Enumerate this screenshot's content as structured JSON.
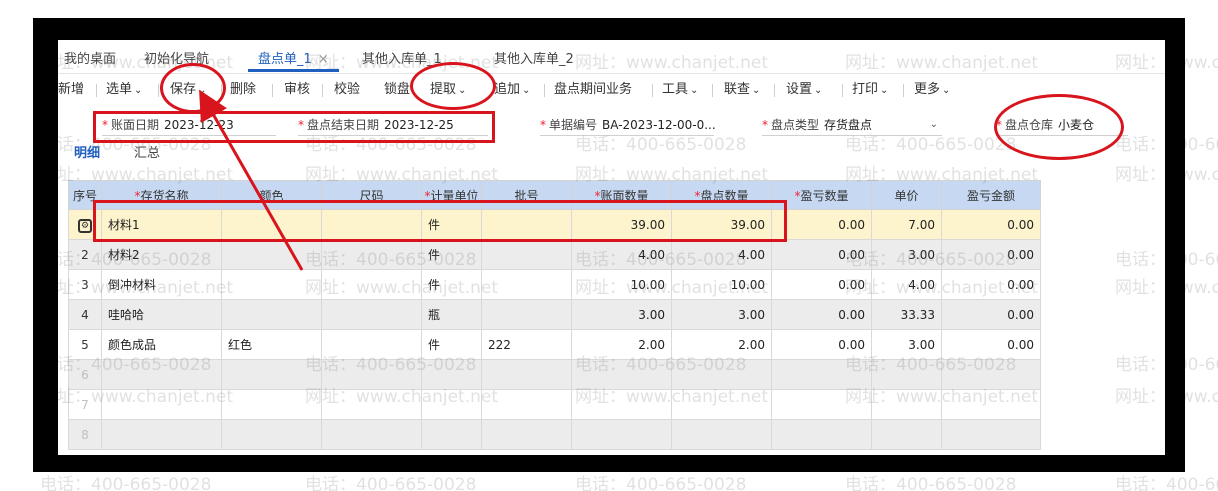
{
  "tabs": {
    "items": [
      {
        "label": "我的桌面"
      },
      {
        "label": "初始化导航"
      },
      {
        "label": "盘点单_1"
      },
      {
        "label": "其他入库单_1"
      },
      {
        "label": "其他入库单_2"
      }
    ],
    "close_glyph": "×"
  },
  "toolbar": {
    "new": "新增",
    "select": "选单",
    "save": "保存",
    "delete": "删除",
    "audit": "审核",
    "verify": "校验",
    "lock": "锁盘",
    "extract": "提取",
    "append": "追加",
    "period_business": "盘点期间业务",
    "tools": "工具",
    "linked": "联查",
    "settings": "设置",
    "print": "打印",
    "more": "更多",
    "chevron": "⌄"
  },
  "form": {
    "book_date": {
      "label": "账面日期",
      "value": "2023-12-23"
    },
    "count_end_date": {
      "label": "盘点结束日期",
      "value": "2023-12-25"
    },
    "doc_no": {
      "label": "单据编号",
      "value": "BA-2023-12-00-0..."
    },
    "count_type": {
      "label": "盘点类型",
      "value": "存货盘点"
    },
    "warehouse": {
      "label": "盘点仓库",
      "value": "小麦仓"
    },
    "required_mark": "*"
  },
  "subtabs": {
    "detail": "明细",
    "summary": "汇总"
  },
  "grid": {
    "headers": {
      "idx": "序号",
      "name": "存货名称",
      "color": "颜色",
      "size": "尺码",
      "unit": "计量单位",
      "batch": "批号",
      "book_qty": "账面数量",
      "count_qty": "盘点数量",
      "diff_qty": "盈亏数量",
      "price": "单价",
      "diff_amt": "盈亏金额"
    },
    "required_mark": "*",
    "rows": [
      {
        "idx": "",
        "name": "材料1",
        "color": "",
        "size": "",
        "unit": "件",
        "batch": "",
        "book_qty": "39.00",
        "count_qty": "39.00",
        "diff_qty": "0.00",
        "price": "7.00",
        "diff_amt": "0.00"
      },
      {
        "idx": "2",
        "name": "材料2",
        "color": "",
        "size": "",
        "unit": "件",
        "batch": "",
        "book_qty": "4.00",
        "count_qty": "4.00",
        "diff_qty": "0.00",
        "price": "3.00",
        "diff_amt": "0.00"
      },
      {
        "idx": "3",
        "name": "倒冲材料",
        "color": "",
        "size": "",
        "unit": "件",
        "batch": "",
        "book_qty": "10.00",
        "count_qty": "10.00",
        "diff_qty": "0.00",
        "price": "4.00",
        "diff_amt": "0.00"
      },
      {
        "idx": "4",
        "name": "哇哈哈",
        "color": "",
        "size": "",
        "unit": "瓶",
        "batch": "",
        "book_qty": "3.00",
        "count_qty": "3.00",
        "diff_qty": "0.00",
        "price": "33.33",
        "diff_amt": "0.00"
      },
      {
        "idx": "5",
        "name": "颜色成品",
        "color": "红色",
        "size": "",
        "unit": "件",
        "batch": "222",
        "book_qty": "2.00",
        "count_qty": "2.00",
        "diff_qty": "0.00",
        "price": "3.00",
        "diff_amt": "0.00"
      },
      {
        "idx": "6",
        "name": "",
        "color": "",
        "size": "",
        "unit": "",
        "batch": "",
        "book_qty": "",
        "count_qty": "",
        "diff_qty": "",
        "price": "",
        "diff_amt": ""
      },
      {
        "idx": "7",
        "name": "",
        "color": "",
        "size": "",
        "unit": "",
        "batch": "",
        "book_qty": "",
        "count_qty": "",
        "diff_qty": "",
        "price": "",
        "diff_amt": ""
      },
      {
        "idx": "8",
        "name": "",
        "color": "",
        "size": "",
        "unit": "",
        "batch": "",
        "book_qty": "",
        "count_qty": "",
        "diff_qty": "",
        "price": "",
        "diff_amt": ""
      }
    ],
    "row_icon": "gear-icon"
  },
  "watermark": {
    "phone": "电话：400-665-0028",
    "site": "网址：www.chanjet.net"
  },
  "colors": {
    "accent": "#1f5fbf",
    "annotation": "#d8141c",
    "header_bg": "#c6d8f2",
    "selected_row": "#fdf4cd"
  }
}
